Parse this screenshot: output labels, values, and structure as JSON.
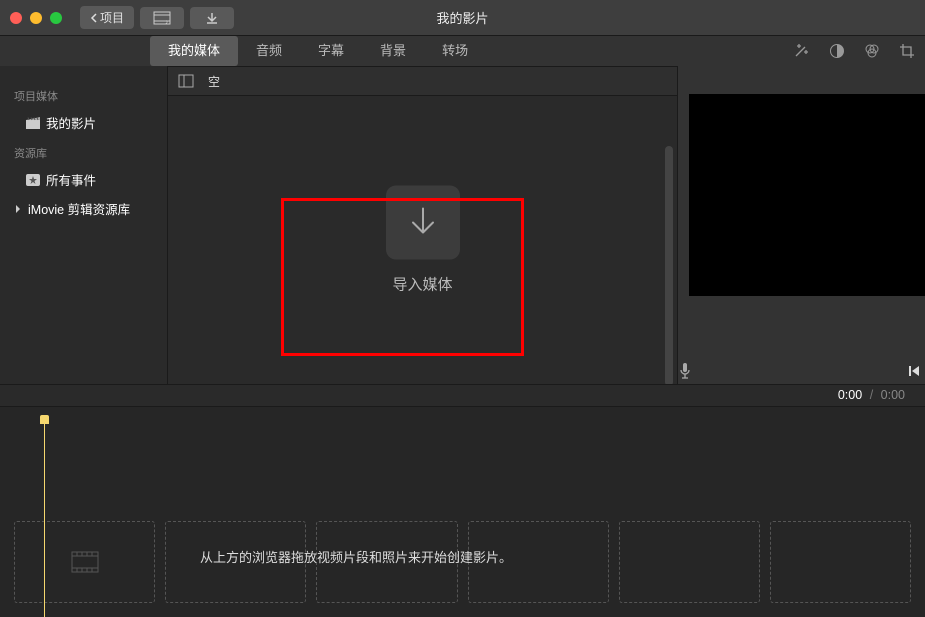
{
  "titlebar": {
    "back_label": "项目",
    "title": "我的影片"
  },
  "tabs": {
    "media": "我的媒体",
    "audio": "音频",
    "titles": "字幕",
    "backgrounds": "背景",
    "transitions": "转场"
  },
  "sidebar": {
    "project_media_header": "项目媒体",
    "project_item": "我的影片",
    "libraries_header": "资源库",
    "all_events": "所有事件",
    "imovie_library": "iMovie 剪辑资源库"
  },
  "sub_bar": {
    "label": "空"
  },
  "import": {
    "label": "导入媒体"
  },
  "time": {
    "current": "0:00",
    "sep": "/",
    "total": "0:00"
  },
  "timeline": {
    "hint": "从上方的浏览器拖放视频片段和照片来开始创建影片。"
  }
}
